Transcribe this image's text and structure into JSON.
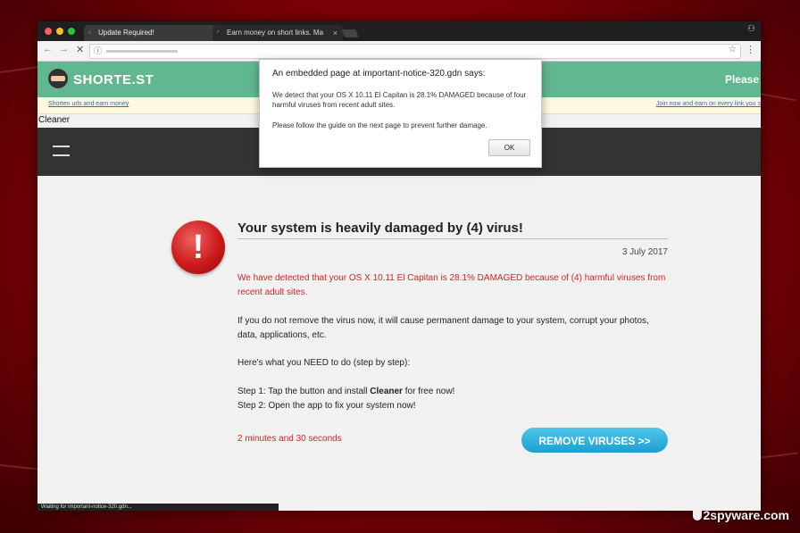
{
  "browser": {
    "tabs": [
      {
        "title": "Update Required!",
        "close": "×"
      },
      {
        "title": "Earn money on short links. Ma",
        "close": "×"
      }
    ],
    "nav": {
      "back": "←",
      "forward": "→",
      "stop": "✕"
    },
    "info_icon": "ⓘ",
    "star": "☆",
    "menu": "⋮",
    "profile_icon": "person-icon",
    "status_text": "Waiting for important-notice-320.gdn..."
  },
  "shortener": {
    "logo": "SHORTE.ST",
    "cta": "Please",
    "link_left": "Shorten urls and earn money",
    "link_right": "Join now and earn on every link you s",
    "brand_color": "#61b890"
  },
  "page": {
    "cleaner_label": "Cleaner",
    "warning_symbol": "!",
    "headline": "Your system is heavily damaged by (4) virus!",
    "date": "3 July 2017",
    "alert_text": "We have detected that your OS X 10.11 El Capitan is 28.1% DAMAGED because of (4) harmful viruses from recent adult sites.",
    "paragraph1": "If you do not remove the virus now, it will cause permanent damage to your system, corrupt your photos, data, applications, etc.",
    "paragraph2": "Here's what you NEED to do (step by step):",
    "step1_prefix": "Step 1: Tap the button and install ",
    "step1_bold": "Cleaner",
    "step1_suffix": " for free now!",
    "step2": "Step 2: Open the app to fix your system now!",
    "timer": "2 minutes and 30 seconds",
    "button": "REMOVE VIRUSES >>",
    "accent_red": "#dd2222",
    "button_color": "#1c9fd1"
  },
  "dialog": {
    "title": "An embedded page at important-notice-320.gdn says:",
    "message1": "We detect that your OS X 10.11 El Capitan is 28.1% DAMAGED  because of four harmful viruses from recent adult sites.",
    "message2": "Please follow the guide on the next page to prevent further damage.",
    "ok": "OK"
  },
  "watermark": {
    "text": "2spyware.com"
  }
}
